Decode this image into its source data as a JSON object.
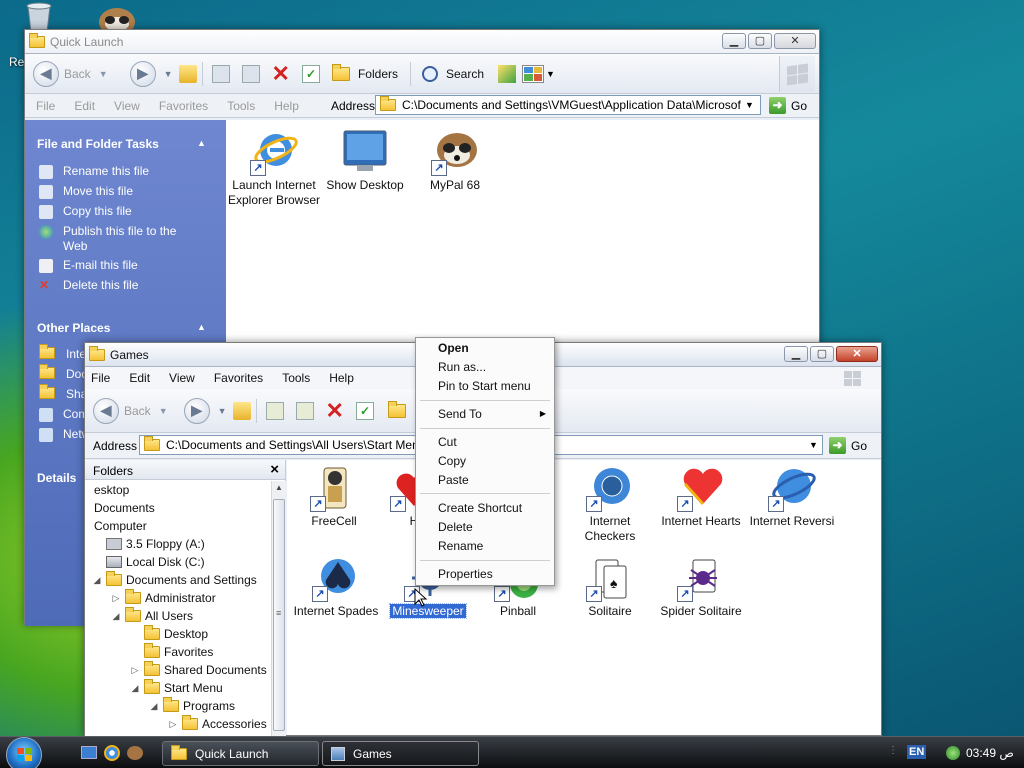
{
  "desktop": {
    "partial_label": "Re"
  },
  "quick_launch_window": {
    "title": "Quick Launch",
    "toolbar": {
      "back": "Back",
      "folders": "Folders",
      "search": "Search"
    },
    "menu": [
      "File",
      "Edit",
      "View",
      "Favorites",
      "Tools",
      "Help"
    ],
    "address_label": "Address",
    "address_value": "C:\\Documents and Settings\\VMGuest\\Application Data\\Microsof",
    "go_label": "Go",
    "file_tasks": {
      "header": "File and Folder Tasks",
      "items": [
        "Rename this file",
        "Move this file",
        "Copy this file",
        "Publish this file to the Web",
        "E-mail this file",
        "Delete this file"
      ]
    },
    "other_places": {
      "header": "Other Places",
      "items": [
        "Inte",
        "Doc",
        "Shar",
        "Com",
        "Netw"
      ]
    },
    "details_header": "Details",
    "icons": [
      {
        "label": "Launch Internet Explorer Browser",
        "icon": "ie-icon"
      },
      {
        "label": "Show Desktop",
        "icon": "desktop-icon"
      },
      {
        "label": "MyPal 68",
        "icon": "raccoon-icon"
      }
    ]
  },
  "games_window": {
    "title": "Games",
    "menu": [
      "File",
      "Edit",
      "View",
      "Favorites",
      "Tools",
      "Help"
    ],
    "toolbar": {
      "back": "Back"
    },
    "address_label": "Address",
    "address_value": "C:\\Documents and Settings\\All Users\\Start Menu",
    "go_label": "Go",
    "folders_pane": {
      "title": "Folders",
      "close": "×",
      "tree": [
        {
          "label": "esktop",
          "depth": 0,
          "twisty": ""
        },
        {
          "label": "Documents",
          "depth": 0,
          "twisty": ""
        },
        {
          "label": "Computer",
          "depth": 0,
          "twisty": ""
        },
        {
          "label": "3.5 Floppy (A:)",
          "depth": 1,
          "twisty": ""
        },
        {
          "label": "Local Disk (C:)",
          "depth": 1,
          "twisty": ""
        },
        {
          "label": "Documents and Settings",
          "depth": 1,
          "twisty": "◢"
        },
        {
          "label": "Administrator",
          "depth": 2,
          "twisty": "▷"
        },
        {
          "label": "All Users",
          "depth": 2,
          "twisty": "◢"
        },
        {
          "label": "Desktop",
          "depth": 3,
          "twisty": ""
        },
        {
          "label": "Favorites",
          "depth": 3,
          "twisty": ""
        },
        {
          "label": "Shared Documents",
          "depth": 3,
          "twisty": "▷"
        },
        {
          "label": "Start Menu",
          "depth": 3,
          "twisty": "◢"
        },
        {
          "label": "Programs",
          "depth": 4,
          "twisty": "◢"
        },
        {
          "label": "Accessories",
          "depth": 5,
          "twisty": "▷"
        }
      ]
    },
    "icons": [
      {
        "label": "FreeCell",
        "icon": "freecell-icon"
      },
      {
        "label": "H",
        "icon": "hearts-icon"
      },
      {
        "label": "Internet Checkers",
        "icon": "internet-checkers-icon"
      },
      {
        "label": "Internet Hearts",
        "icon": "internet-hearts-icon"
      },
      {
        "label": "Internet Reversi",
        "icon": "internet-reversi-icon"
      },
      {
        "label": "Internet Spades",
        "icon": "internet-spades-icon"
      },
      {
        "label": "Minesweeper",
        "icon": "minesweeper-icon",
        "selected": true
      },
      {
        "label": "Pinball",
        "icon": "pinball-icon"
      },
      {
        "label": "Solitaire",
        "icon": "solitaire-icon"
      },
      {
        "label": "Spider Solitaire",
        "icon": "spider-solitaire-icon"
      }
    ]
  },
  "context_menu": {
    "items": [
      "Open",
      "Run as...",
      "Pin to Start menu",
      "Send To",
      "Cut",
      "Copy",
      "Paste",
      "Create Shortcut",
      "Delete",
      "Rename",
      "Properties"
    ]
  },
  "taskbar": {
    "tasks": [
      "Quick Launch",
      "Games"
    ],
    "language": "EN",
    "clock": "ص 03:49"
  },
  "colors": {
    "task_pane": "#5f7ac4",
    "selection": "#3369d3",
    "close_red": "#c5412a"
  }
}
